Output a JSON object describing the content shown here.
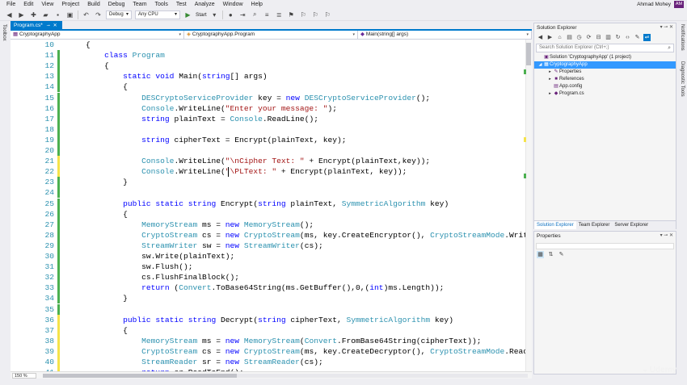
{
  "menu": [
    "File",
    "Edit",
    "View",
    "Project",
    "Build",
    "Debug",
    "Team",
    "Tools",
    "Test",
    "Analyze",
    "Window",
    "Help"
  ],
  "user": {
    "name": "Ahmad Mohey",
    "initials": "AM"
  },
  "toolbar": {
    "config": "Debug",
    "platform": "Any CPU",
    "start_label": "Start"
  },
  "side_labels": {
    "left": "Toolbox",
    "right": [
      "Notifications",
      "Diagnostic Tools"
    ]
  },
  "tab": {
    "label": "Program.cs*"
  },
  "navbar": {
    "project": "CryptographyApp",
    "class": "CryptographyApp.Program",
    "member": "Main(string[] args)"
  },
  "code_lines": [
    {
      "n": "10",
      "t": "    {",
      "m": ""
    },
    {
      "n": "11",
      "t": "        class Program",
      "m": "green"
    },
    {
      "n": "12",
      "t": "        {",
      "m": "green"
    },
    {
      "n": "13",
      "t": "            static void Main(string[] args)",
      "m": "green"
    },
    {
      "n": "14",
      "t": "            {",
      "m": "green"
    },
    {
      "n": "15",
      "t": "                DESCryptoServiceProvider key = new DESCryptoServiceProvider();",
      "m": "green"
    },
    {
      "n": "16",
      "t": "                Console.WriteLine(\"Enter your message: \");",
      "m": "green"
    },
    {
      "n": "17",
      "t": "                string plainText = Console.ReadLine();",
      "m": "green"
    },
    {
      "n": "18",
      "t": "",
      "m": "green"
    },
    {
      "n": "19",
      "t": "                string cipherText = Encrypt(plainText, key);",
      "m": "green"
    },
    {
      "n": "20",
      "t": "",
      "m": "green"
    },
    {
      "n": "21",
      "t": "                Console.WriteLine(\"\\nCipher Text: \" + Encrypt(plainText,key));",
      "m": "yellow"
    },
    {
      "n": "22",
      "t": "                Console.WriteLine(\"\\PLText: \" + Encrypt(plainText, key));",
      "m": "yellow"
    },
    {
      "n": "23",
      "t": "            }",
      "m": "green"
    },
    {
      "n": "24",
      "t": "",
      "m": "green"
    },
    {
      "n": "25",
      "t": "            public static string Encrypt(string plainText, SymmetricAlgorithm key)",
      "m": "green"
    },
    {
      "n": "26",
      "t": "            {",
      "m": "green"
    },
    {
      "n": "27",
      "t": "                MemoryStream ms = new MemoryStream();",
      "m": "green"
    },
    {
      "n": "28",
      "t": "                CryptoStream cs = new CryptoStream(ms, key.CreateEncryptor(), CryptoStreamMode.Write);",
      "m": "green"
    },
    {
      "n": "29",
      "t": "                StreamWriter sw = new StreamWriter(cs);",
      "m": "green"
    },
    {
      "n": "30",
      "t": "                sw.Write(plainText);",
      "m": "green"
    },
    {
      "n": "31",
      "t": "                sw.Flush();",
      "m": "green"
    },
    {
      "n": "32",
      "t": "                cs.FlushFinalBlock();",
      "m": "green"
    },
    {
      "n": "33",
      "t": "                return (Convert.ToBase64String(ms.GetBuffer(),0,(int)ms.Length));",
      "m": "green"
    },
    {
      "n": "34",
      "t": "            }",
      "m": "green"
    },
    {
      "n": "35",
      "t": "",
      "m": "green"
    },
    {
      "n": "36",
      "t": "            public static string Decrypt(string cipherText, SymmetricAlgorithm key)",
      "m": "yellow"
    },
    {
      "n": "37",
      "t": "            {",
      "m": "yellow"
    },
    {
      "n": "38",
      "t": "                MemoryStream ms = new MemoryStream(Convert.FromBase64String(cipherText));",
      "m": "yellow"
    },
    {
      "n": "39",
      "t": "                CryptoStream cs = new CryptoStream(ms, key.CreateDecryptor(), CryptoStreamMode.Read);",
      "m": "yellow"
    },
    {
      "n": "40",
      "t": "                StreamReader sr = new StreamReader(cs);",
      "m": "yellow"
    },
    {
      "n": "41",
      "t": "                return sr.ReadToEnd();",
      "m": "yellow"
    }
  ],
  "solution_explorer": {
    "title": "Solution Explorer",
    "search_placeholder": "Search Solution Explorer (Ctrl+;)",
    "tree": [
      {
        "label": "Solution 'CryptographyApp' (1 project)",
        "depth": 0,
        "arrow": "",
        "icon": "solution-icon",
        "glyph": "▣",
        "selected": false
      },
      {
        "label": "CryptographyApp",
        "depth": 0,
        "arrow": "◢",
        "icon": "csharp-project-icon",
        "glyph": "▦",
        "selected": true
      },
      {
        "label": "Properties",
        "depth": 1,
        "arrow": "▸",
        "icon": "wrench-icon",
        "glyph": "✎",
        "selected": false
      },
      {
        "label": "References",
        "depth": 1,
        "arrow": "▸",
        "icon": "references-icon",
        "glyph": "■",
        "selected": false
      },
      {
        "label": "App.config",
        "depth": 1,
        "arrow": "",
        "icon": "config-file-icon",
        "glyph": "▤",
        "selected": false
      },
      {
        "label": "Program.cs",
        "depth": 1,
        "arrow": "▸",
        "icon": "csharp-file-icon",
        "glyph": "◆",
        "selected": false
      }
    ],
    "tabs": [
      "Solution Explorer",
      "Team Explorer",
      "Server Explorer"
    ]
  },
  "properties": {
    "title": "Properties"
  },
  "status": {
    "zoom": "150 %"
  },
  "watermark": "Udemy",
  "colors": {
    "accent": "#007acc",
    "keyword": "#0000ff",
    "type": "#2b91af",
    "string": "#a31515",
    "change_saved": "#4cb050",
    "change_unsaved": "#f5e34a"
  }
}
